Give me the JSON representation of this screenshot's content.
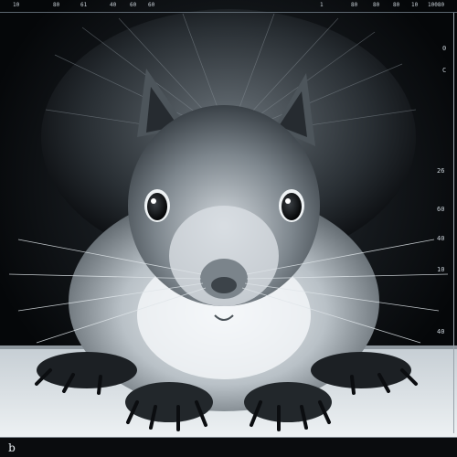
{
  "image": {
    "subject": "squirrel",
    "palette": {
      "background": "#050709",
      "fur_light": "#e6ebef",
      "fur_dark": "#3b4248",
      "floor": "#dfe6ea"
    }
  },
  "top_scale": {
    "labels": [
      "10",
      "80",
      "61",
      "40",
      "60",
      "60",
      "1",
      "80",
      "80",
      "80",
      "10",
      "10080"
    ]
  },
  "right_scale": {
    "labels": [
      "0",
      "C",
      "26",
      "60",
      "40",
      "10",
      "40"
    ]
  },
  "logo": {
    "glyph": "b"
  }
}
